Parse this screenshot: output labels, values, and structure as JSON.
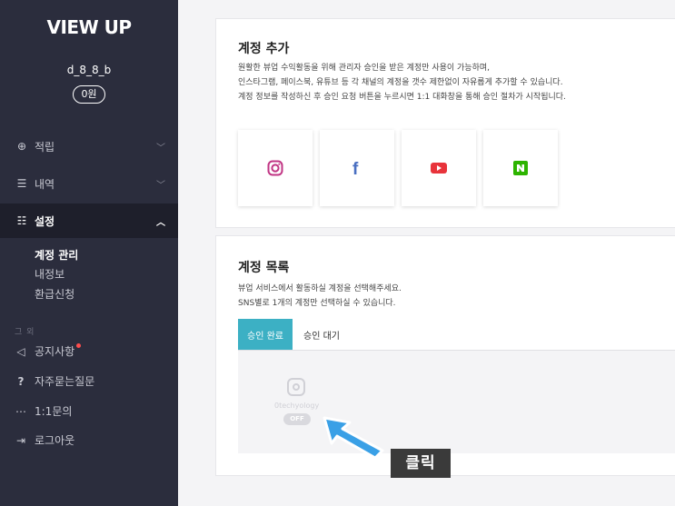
{
  "sidebar": {
    "logo": "VIEW UP",
    "username": "d_8_8_b",
    "points": "0원",
    "nav": [
      {
        "label": "적립",
        "icon": "coin-icon"
      },
      {
        "label": "내역",
        "icon": "list-icon"
      },
      {
        "label": "설정",
        "icon": "sliders-icon"
      }
    ],
    "settings_sub": [
      "계정 관리",
      "내정보",
      "환급신청"
    ],
    "section_label": "그 외",
    "menu": [
      {
        "label": "공지사항",
        "icon": "megaphone-icon"
      },
      {
        "label": "자주묻는질문",
        "icon": "question-icon"
      },
      {
        "label": "1:1문의",
        "icon": "chat-icon"
      },
      {
        "label": "로그아웃",
        "icon": "logout-icon"
      }
    ]
  },
  "add_account": {
    "title": "계정 추가",
    "desc": [
      "원활한 뷰업 수익활동을 위해 관리자 승인을 받은 계정만 사용이 가능하며,",
      "인스타그램, 페이스북, 유튜브 등 각 채널의 계정을 갯수 제한없이 자유롭게 추가할 수 있습니다.",
      "계정 정보를 작성하신 후 승인 요청 버튼을 누르시면 1:1 대화창을 통해 승인 절차가 시작됩니다."
    ],
    "sns": [
      {
        "name": "instagram-icon",
        "color": "#c13584"
      },
      {
        "name": "facebook-icon",
        "color": "#4a6fc1"
      },
      {
        "name": "youtube-icon",
        "color": "#e8333b"
      },
      {
        "name": "naver-icon",
        "color": "#2db400"
      }
    ]
  },
  "account_list": {
    "title": "계정 목록",
    "desc": [
      "뷰업 서비스에서 활동하실 계정을 선택해주세요.",
      "SNS별로 1개의 계정만 선택하실 수 있습니다."
    ],
    "tabs": [
      "승인 완료",
      "승인 대기"
    ],
    "account": {
      "name": "0techyology",
      "status": "OFF"
    }
  },
  "annotation": {
    "label": "클릭"
  },
  "colors": {
    "sidebar": "#2b2d3d",
    "accent": "#3cb0c4",
    "arrow": "#3aa0e6"
  }
}
